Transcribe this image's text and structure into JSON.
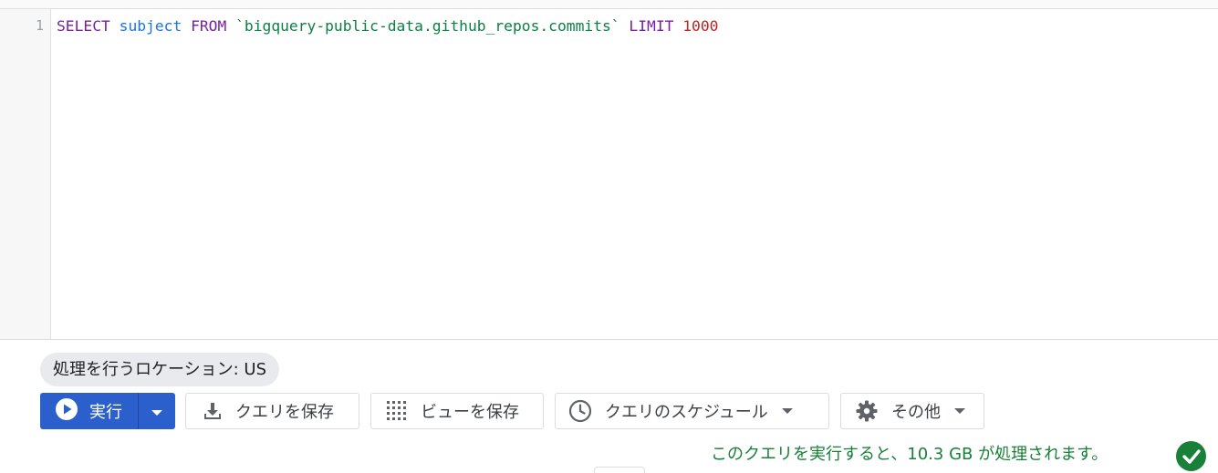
{
  "editor": {
    "line_number": "1",
    "code": {
      "select_kw": "SELECT",
      "column": "subject",
      "from_kw": "FROM",
      "table": "`bigquery-public-data.github_repos.commits`",
      "limit_kw": "LIMIT",
      "limit_value": "1000"
    }
  },
  "location": {
    "label": "処理を行うロケーション: US"
  },
  "toolbar": {
    "run_label": "実行",
    "save_query_label": "クエリを保存",
    "save_view_label": "ビューを保存",
    "schedule_label": "クエリのスケジュール",
    "more_label": "その他"
  },
  "status": {
    "message": "このクエリを実行すると、10.3 GB が処理されます。"
  },
  "colors": {
    "run_button": "#2b5fcb",
    "status_ok": "#188038"
  }
}
